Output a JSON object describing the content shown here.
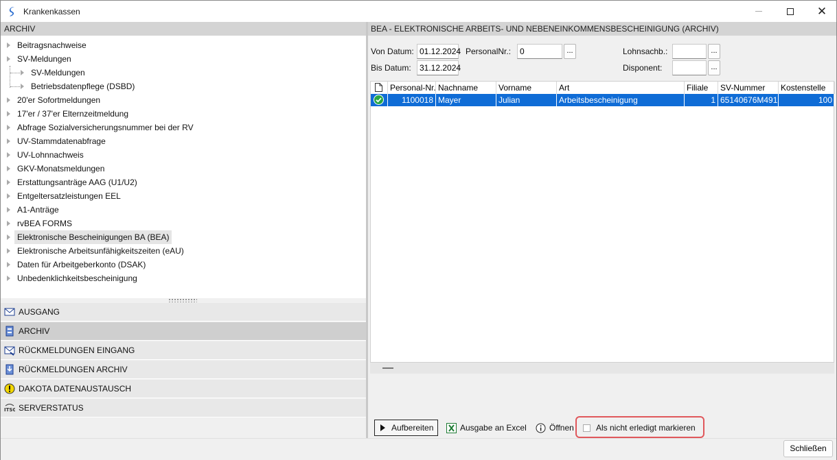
{
  "window": {
    "title": "Krankenkassen"
  },
  "left": {
    "header": "ARCHIV",
    "tree": [
      {
        "label": "Beitragsnachweise",
        "indent": 0
      },
      {
        "label": "SV-Meldungen",
        "indent": 0
      },
      {
        "label": "SV-Meldungen",
        "indent": 1
      },
      {
        "label": "Betriebsdatenpflege (DSBD)",
        "indent": 1
      },
      {
        "label": "20'er Sofortmeldungen",
        "indent": 0
      },
      {
        "label": "17'er / 37'er Elternzeitmeldung",
        "indent": 0
      },
      {
        "label": "Abfrage Sozialversicherungsnummer bei der RV",
        "indent": 0
      },
      {
        "label": "UV-Stammdatenabfrage",
        "indent": 0
      },
      {
        "label": "UV-Lohnnachweis",
        "indent": 0
      },
      {
        "label": "GKV-Monatsmeldungen",
        "indent": 0
      },
      {
        "label": "Erstattungsanträge AAG (U1/U2)",
        "indent": 0
      },
      {
        "label": "Entgeltersatzleistungen EEL",
        "indent": 0
      },
      {
        "label": "A1-Anträge",
        "indent": 0
      },
      {
        "label": "rvBEA FORMS",
        "indent": 0
      },
      {
        "label": "Elektronische Bescheinigungen BA (BEA)",
        "indent": 0,
        "selected": true
      },
      {
        "label": "Elektronische Arbeitsunfähigkeitszeiten (eAU)",
        "indent": 0
      },
      {
        "label": "Daten für Arbeitgeberkonto (DSAK)",
        "indent": 0
      },
      {
        "label": "Unbedenklichkeitsbescheinigung",
        "indent": 0
      }
    ],
    "nav": [
      {
        "label": "AUSGANG",
        "icon": "envelope-icon"
      },
      {
        "label": "ARCHIV",
        "icon": "archive-icon",
        "active": true
      },
      {
        "label": "RÜCKMELDUNGEN EINGANG",
        "icon": "envelope-in-icon"
      },
      {
        "label": "RÜCKMELDUNGEN ARCHIV",
        "icon": "archive-in-icon"
      },
      {
        "label": "DAKOTA DATENAUSTAUSCH",
        "icon": "warning-icon"
      },
      {
        "label": "SERVERSTATUS",
        "icon": "itsg-icon"
      }
    ]
  },
  "right": {
    "header": "BEA - ELEKTRONISCHE ARBEITS- UND NEBENEINKOMMENSBESCHEINIGUNG (ARCHIV)",
    "filters": {
      "von_label": "Von Datum:",
      "von_value": "01.12.2024",
      "bis_label": "Bis Datum:",
      "bis_value": "31.12.2024",
      "personal_label": "PersonalNr.:",
      "personal_value": "0",
      "lohnsachb_label": "Lohnsachb.:",
      "lohnsachb_value": "",
      "disponent_label": "Disponent:",
      "disponent_value": "",
      "dots": "..."
    },
    "columns": [
      "Personal-Nr.",
      "Nachname",
      "Vorname",
      "Art",
      "Filiale",
      "SV-Nummer",
      "Kostenstelle"
    ],
    "rows": [
      {
        "personal": "1100018",
        "nachname": "Mayer",
        "vorname": "Julian",
        "art": "Arbeitsbescheinigung",
        "filiale": "1",
        "sv": "65140676M491",
        "kostenstelle": "100"
      }
    ],
    "actions": {
      "aufbereiten": "Aufbereiten",
      "excel": "Ausgabe an Excel",
      "oeffnen": "Öffnen",
      "nicht_erledigt": "Als nicht erledigt markieren"
    }
  },
  "footer": {
    "close": "Schließen"
  },
  "colors": {
    "selection": "#0f6cd6",
    "highlight": "#e0575b",
    "excel": "#1e7b34",
    "warning": "#f2d600"
  }
}
